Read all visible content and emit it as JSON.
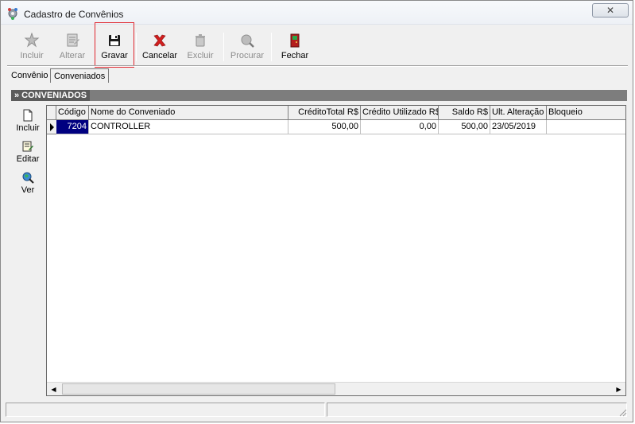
{
  "window": {
    "title": "Cadastro de Convênios",
    "close_label": "✕"
  },
  "toolbar": {
    "incluir": "Incluir",
    "alterar": "Alterar",
    "gravar": "Gravar",
    "cancelar": "Cancelar",
    "excluir": "Excluir",
    "procurar": "Procurar",
    "fechar": "Fechar"
  },
  "tabs": {
    "convenio": "Convênio",
    "conveniados": "Conveniados"
  },
  "panel": {
    "title": "» CONVENIADOS"
  },
  "side": {
    "incluir": "Incluir",
    "editar": "Editar",
    "ver": "Ver"
  },
  "grid": {
    "columns": {
      "codigo": "Código",
      "nome": "Nome do Conveniado",
      "credito_total": "CréditoTotal R$",
      "credito_utilizado": "Crédito Utilizado R$",
      "saldo": "Saldo R$",
      "ult_alteracao": "Ult. Alteração",
      "bloqueio": "Bloqueio"
    },
    "rows": [
      {
        "codigo": "7204",
        "nome": "CONTROLLER",
        "credito_total": "500,00",
        "credito_utilizado": "0,00",
        "saldo": "500,00",
        "ult_alteracao": "23/05/2019",
        "bloqueio": ""
      }
    ]
  },
  "colors": {
    "highlight_box": "#e0262e",
    "selected_cell": "#000080",
    "cancel_icon": "#d21f1f",
    "fechar_icon": "#b41c1c"
  }
}
